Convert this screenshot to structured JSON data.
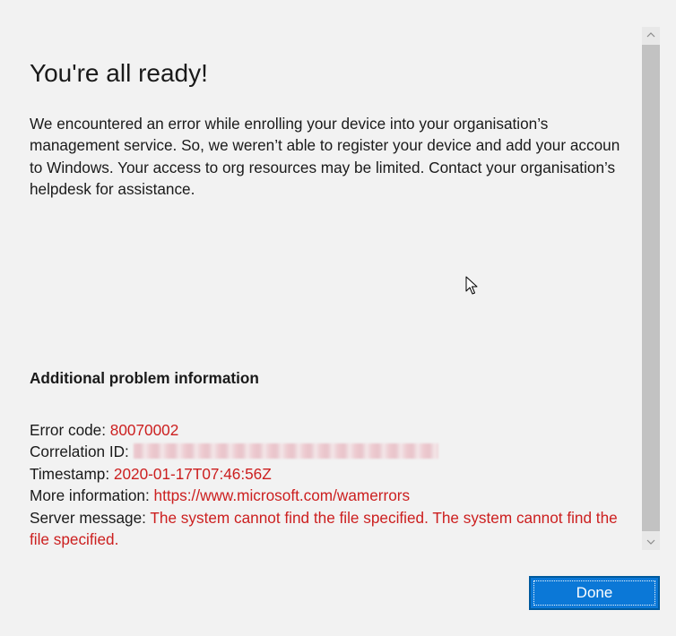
{
  "dialog": {
    "title": "You're all ready!",
    "message": "We encountered an error while enrolling your device into your organisation’s\nmanagement service. So, we weren’t able to register your device and add your accoun\nto Windows. Your access to org resources may be limited. Contact your organisation’s\nhelpdesk for assistance.",
    "section_heading": "Additional problem information",
    "details": {
      "error_code_label": "Error code:",
      "error_code_value": "80070002",
      "correlation_id_label": "Correlation ID:",
      "timestamp_label": "Timestamp:",
      "timestamp_value": "2020-01-17T07:46:56Z",
      "more_info_label": "More information:",
      "more_info_link": "https://www.microsoft.com/wamerrors",
      "server_message_label": "Server message:",
      "server_message_value": "The system cannot find the file specified. The system cannot find the file specified."
    },
    "done_label": "Done"
  },
  "icons": {
    "scroll_up": "chevron-up-icon",
    "scroll_down": "chevron-down-icon",
    "cursor": "mouse-pointer-icon"
  },
  "colors": {
    "background": "#f2f2f2",
    "text": "#1a1a1a",
    "error_value": "#cc1f1f",
    "accent": "#0b78d7",
    "scrollbar_track": "#e8e8e8",
    "scrollbar_thumb": "#c2c2c2"
  }
}
